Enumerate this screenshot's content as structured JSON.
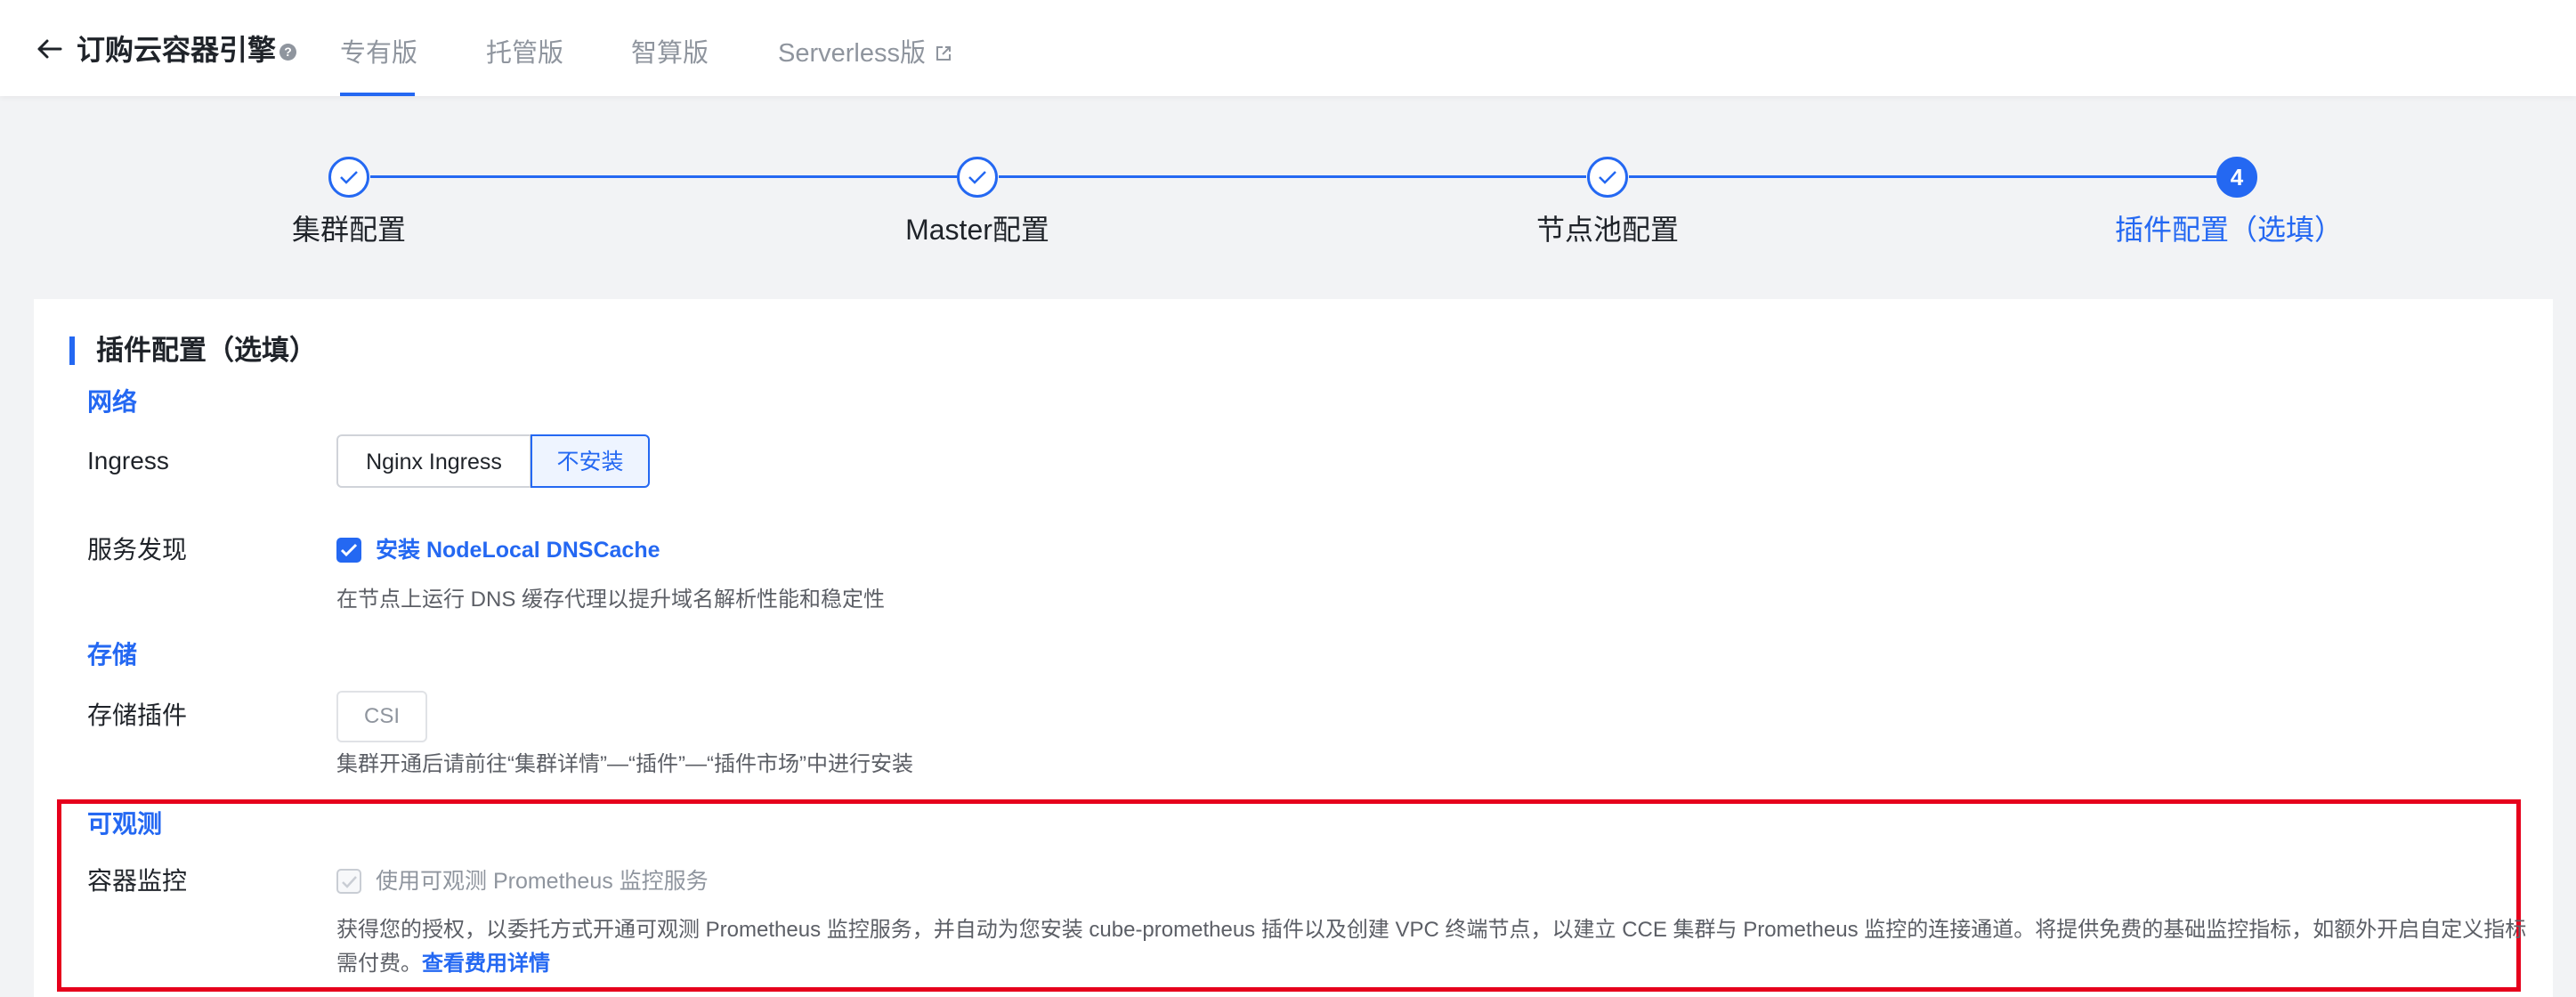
{
  "header": {
    "title": "订购云容器引擎",
    "help_icon": "?",
    "tabs": [
      {
        "label": "专有版",
        "active": true
      },
      {
        "label": "托管版",
        "active": false
      },
      {
        "label": "智算版",
        "active": false
      },
      {
        "label": "Serverless版",
        "active": false,
        "external": true
      }
    ]
  },
  "steps": [
    {
      "label": "集群配置",
      "status": "done"
    },
    {
      "label": "Master配置",
      "status": "done"
    },
    {
      "label": "节点池配置",
      "status": "done"
    },
    {
      "label": "插件配置（选填）",
      "status": "current",
      "number": "4"
    }
  ],
  "section": {
    "title": "插件配置（选填）",
    "network": {
      "group_title": "网络",
      "ingress_label": "Ingress",
      "ingress_options": [
        {
          "label": "Nginx Ingress",
          "selected": false
        },
        {
          "label": "不安装",
          "selected": true
        }
      ],
      "discovery_label": "服务发现",
      "discovery_checkbox": "安装 NodeLocal DNSCache",
      "discovery_checked": true,
      "discovery_hint": "在节点上运行 DNS 缓存代理以提升域名解析性能和稳定性"
    },
    "storage": {
      "group_title": "存储",
      "plugin_label": "存储插件",
      "csi_button": "CSI",
      "hint": "集群开通后请前往“集群详情”—“插件”—“插件市场”中进行安装"
    },
    "observability": {
      "group_title": "可观测",
      "monitor_label": "容器监控",
      "monitor_checkbox": "使用可观测 Prometheus 监控服务",
      "monitor_checked": true,
      "monitor_disabled": true,
      "description": "获得您的授权，以委托方式开通可观测 Prometheus 监控服务，并自动为您安装 cube-prometheus 插件以及创建 VPC 终端节点，以建立 CCE 集群与 Prometheus 监控的连接通道。将提供免费的基础监控指标，如额外开启自定义指标需付费。",
      "link": "查看费用详情"
    }
  },
  "colors": {
    "accent": "#2468f2",
    "highlight_border": "#e6001c"
  }
}
